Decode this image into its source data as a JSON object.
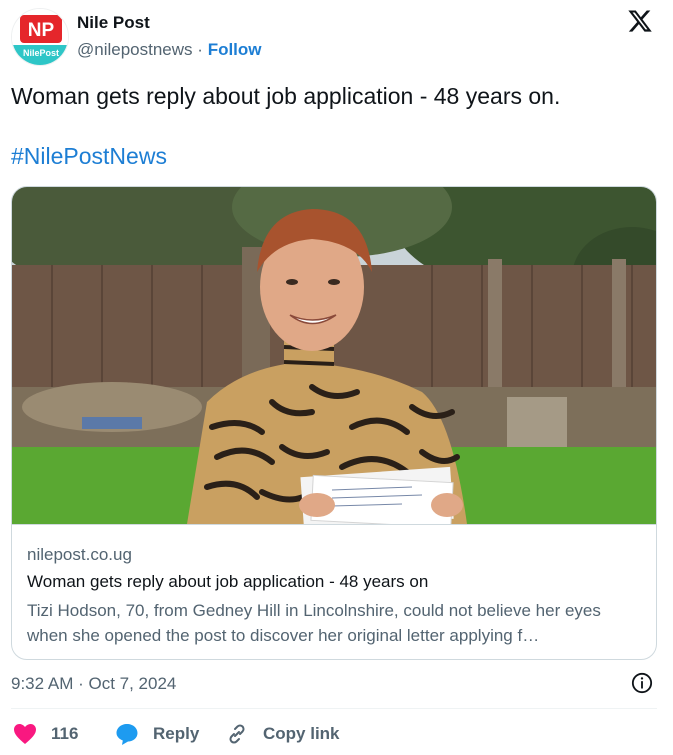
{
  "account": {
    "avatar_letters": "NP",
    "avatar_sub": "NilePost",
    "name": "Nile Post",
    "handle": "@nilepostnews",
    "separator": "·",
    "follow_label": "Follow"
  },
  "tweet": {
    "text": "Woman gets reply about job application - 48 years on.",
    "hashtag": "#NilePostNews"
  },
  "card": {
    "image_icon": "photo-woman-tiger-print-holding-letters",
    "domain": "nilepost.co.ug",
    "title": "Woman gets reply about job application - 48 years on",
    "description": "Tizi Hodson, 70, from Gedney Hill in Lincolnshire, could not believe her eyes when she opened the post to discover her original letter applying f…"
  },
  "meta": {
    "timestamp": "9:32 AM · Oct 7, 2024"
  },
  "actions": {
    "like_count": "116",
    "reply_label": "Reply",
    "copy_label": "Copy link"
  },
  "colors": {
    "accent": "#1d7ed4",
    "like": "#f91880",
    "reply": "#1d9bf0",
    "muted": "#536471",
    "brand_red": "#e5262b",
    "brand_teal": "#2ec6c7"
  }
}
